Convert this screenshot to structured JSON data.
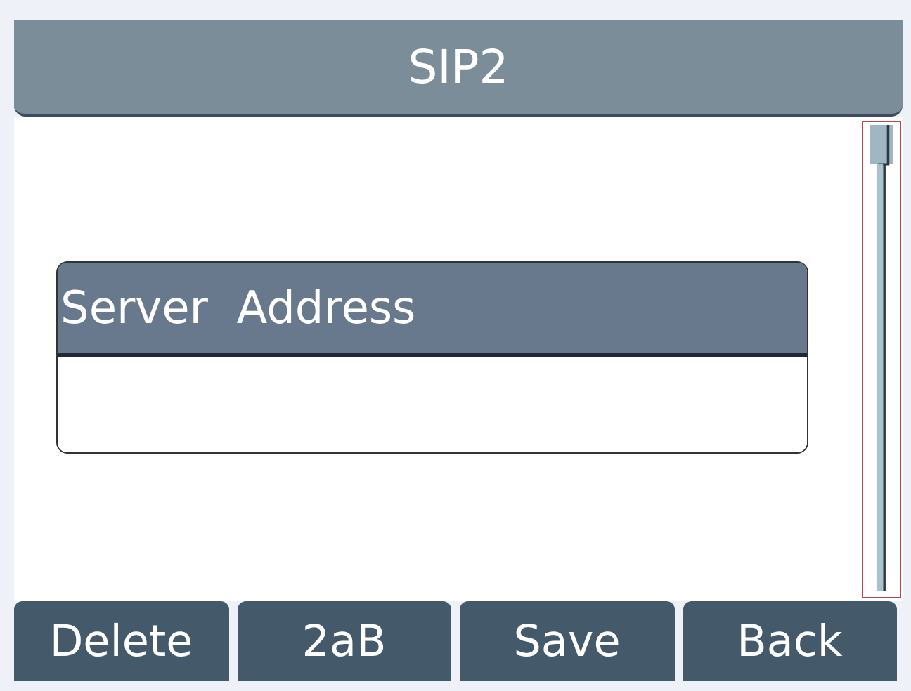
{
  "window": {
    "title": "SIP2"
  },
  "field": {
    "label": "Server  Address"
  },
  "softkeys": [
    {
      "label": "Delete"
    },
    {
      "label": "2aB"
    },
    {
      "label": "Save"
    },
    {
      "label": "Back"
    }
  ]
}
